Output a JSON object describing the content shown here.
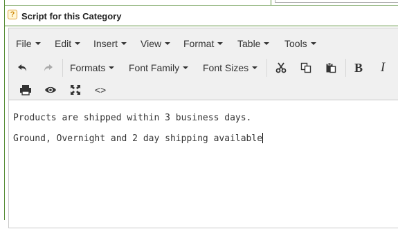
{
  "section": {
    "help_icon": "question-icon",
    "title": "Script for this Category"
  },
  "menubar": {
    "items": [
      {
        "label": "File"
      },
      {
        "label": "Edit"
      },
      {
        "label": "Insert"
      },
      {
        "label": "View"
      },
      {
        "label": "Format"
      },
      {
        "label": "Table"
      },
      {
        "label": "Tools"
      }
    ]
  },
  "toolbar": {
    "undo_icon": "undo-icon",
    "redo_icon": "redo-icon",
    "formats_label": "Formats",
    "font_family_label": "Font Family",
    "font_sizes_label": "Font Sizes",
    "cut_icon": "scissors-icon",
    "copy_icon": "copy-icon",
    "paste_icon": "paste-icon",
    "bold_label": "B",
    "italic_label": "I",
    "print_icon": "print-icon",
    "preview_icon": "eye-icon",
    "fullscreen_icon": "fullscreen-icon",
    "code_label": "<>"
  },
  "content": {
    "paragraphs": [
      "Products are shipped within 3 business days.",
      "Ground, Overnight and 2 day shipping available"
    ]
  },
  "colors": {
    "section_border": "#5a8f3a",
    "help_icon": "#e0a030",
    "toolbar_bg": "#f0f0f0"
  }
}
